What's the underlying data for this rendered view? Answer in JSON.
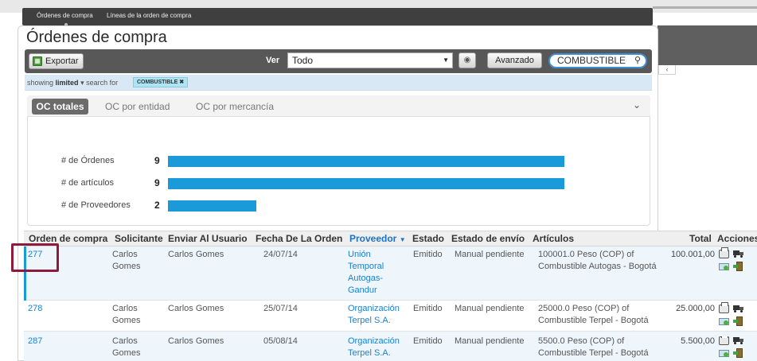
{
  "top_nav": {
    "tabs": [
      "Órdenes de compra",
      "Líneas de la orden de compra"
    ]
  },
  "page": {
    "title": "Órdenes de compra"
  },
  "toolbar": {
    "export_label": "Exportar",
    "view_label": "Ver",
    "view_value": "Todo",
    "advanced_label": "Avanzado",
    "search_value": "COMBUSTIBLE"
  },
  "filter": {
    "showing_prefix": "showing",
    "limited": "limited",
    "search_for": "search for",
    "chip": "COMBUSTIBLE"
  },
  "summary": {
    "tabs": [
      "OC totales",
      "OC por entidad",
      "OC por mercancía"
    ],
    "active_tab": "OC totales",
    "bars": [
      {
        "label": "# de Órdenes",
        "value": 9
      },
      {
        "label": "# de artículos",
        "value": 9
      },
      {
        "label": "# de Proveedores",
        "value": 2
      }
    ],
    "bar_max": 9,
    "bar_color": "#1a9ad8"
  },
  "table": {
    "columns": [
      "Orden de compra",
      "Solicitante",
      "Enviar Al Usuario",
      "Fecha De La Orden",
      "Proveedor",
      "Estado",
      "Estado de envío",
      "Artículos",
      "Total",
      "Acciones"
    ],
    "rows": [
      {
        "order": "277",
        "requester": "Carlos\nGomes",
        "send_to": "Carlos Gomes",
        "date": "24/07/14",
        "supplier": "Unión\nTemporal\nAutogas-\nGandur",
        "status": "Emitido",
        "ship_status": "Manual pendiente",
        "items": "100001.0 Peso (COP) of\nCombustible Autogas - Bogotá",
        "total": "100.001,00"
      },
      {
        "order": "278",
        "requester": "Carlos\nGomes",
        "send_to": "Carlos Gomes",
        "date": "25/07/14",
        "supplier": "Organización\nTerpel S.A.",
        "status": "Emitido",
        "ship_status": "Manual pendiente",
        "items": "25000.0 Peso (COP) of\nCombustible Terpel - Bogotá",
        "total": "25.000,00"
      },
      {
        "order": "287",
        "requester": "Carlos\nGomes",
        "send_to": "Carlos Gomes",
        "date": "05/08/14",
        "supplier": "Organización\nTerpel S.A.",
        "status": "Emitido",
        "ship_status": "Manual pendiente",
        "items": "5500.0 Peso (COP) of\nCombustible Terpel - Bogotá",
        "total": "5.500,00"
      }
    ]
  },
  "icons": {
    "export": "spreadsheet-icon",
    "refresh": "refresh-icon",
    "search": "magnifier-icon",
    "print": "printer-icon",
    "ship": "truck-icon",
    "email": "email-icon",
    "receive": "exit-door-icon"
  }
}
